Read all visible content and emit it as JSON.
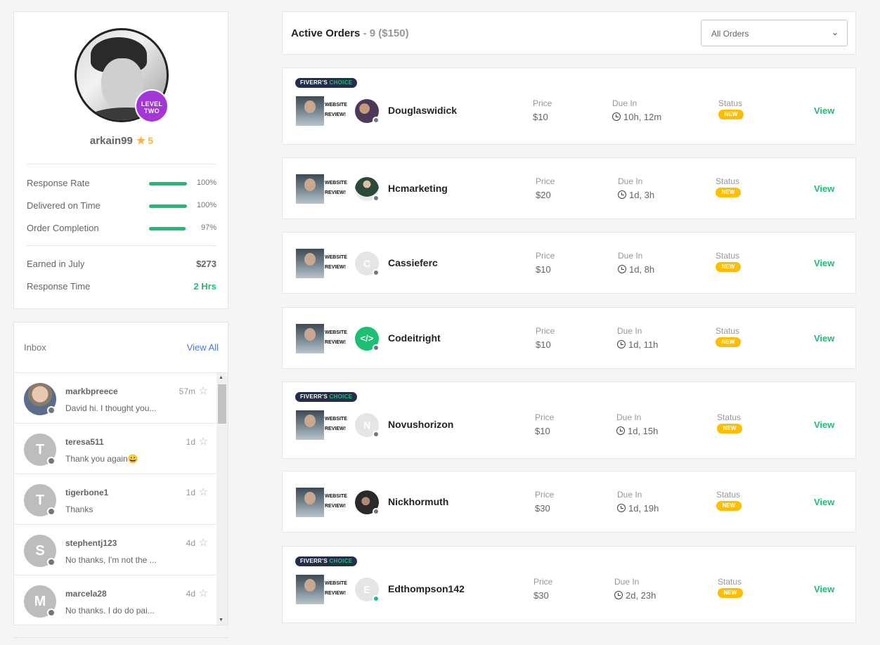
{
  "profile": {
    "username": "arkain99",
    "rating": "5",
    "level_line1": "LEVEL",
    "level_line2": "TWO",
    "stats": [
      {
        "label": "Response Rate",
        "percent_text": "100%",
        "progress": 1.0
      },
      {
        "label": "Delivered on Time",
        "percent_text": "100%",
        "progress": 1.0
      },
      {
        "label": "Order Completion",
        "percent_text": "97%",
        "progress": 0.97
      }
    ],
    "earned_label": "Earned in July",
    "earned_value": "$273",
    "response_time_label": "Response Time",
    "response_time_value": "2 Hrs"
  },
  "inbox": {
    "title": "Inbox",
    "view_all": "View All",
    "messages": [
      {
        "name": "markbpreece",
        "time": "57m",
        "text": "David hi. I thought you...",
        "initial": ""
      },
      {
        "name": "teresa511",
        "time": "1d",
        "text": "Thank you again😀",
        "initial": "T"
      },
      {
        "name": "tigerbone1",
        "time": "1d",
        "text": "Thanks",
        "initial": "T"
      },
      {
        "name": "stephentj123",
        "time": "4d",
        "text": "No thanks, I'm not the ...",
        "initial": "S"
      },
      {
        "name": "marcela28",
        "time": "4d",
        "text": "No thanks. I do do pai...",
        "initial": "M"
      }
    ]
  },
  "orders_header": {
    "title": "Active Orders",
    "count": " - 9 ($150)",
    "filter": "All Orders"
  },
  "labels": {
    "price": "Price",
    "due": "Due In",
    "status": "Status",
    "new": "NEW",
    "view": "View",
    "badge_a": "FIVERR'S ",
    "badge_b": "CHOICE",
    "thumb_line1": "WEBSITE",
    "thumb_line2": "REVIEW!"
  },
  "orders": [
    {
      "buyer": "Douglaswidick",
      "price": "$10",
      "due": "10h, 12m",
      "initial": "",
      "choice": true
    },
    {
      "buyer": "Hcmarketing",
      "price": "$20",
      "due": "1d, 3h",
      "initial": "",
      "choice": false
    },
    {
      "buyer": "Cassieferc",
      "price": "$10",
      "due": "1d, 8h",
      "initial": "C",
      "choice": false
    },
    {
      "buyer": "Codeitright",
      "price": "$10",
      "due": "1d, 11h",
      "initial": "</>",
      "choice": false
    },
    {
      "buyer": "Novushorizon",
      "price": "$10",
      "due": "1d, 15h",
      "initial": "N",
      "choice": true
    },
    {
      "buyer": "Nickhormuth",
      "price": "$30",
      "due": "1d, 19h",
      "initial": "",
      "choice": false
    },
    {
      "buyer": "Edthompson142",
      "price": "$30",
      "due": "2d, 23h",
      "initial": "E",
      "choice": true
    }
  ],
  "colors": {
    "accent_green": "#1dbf73",
    "status_yellow": "#ffbe00",
    "level_purple": "#a436d9",
    "link_blue": "#4a73e8"
  }
}
